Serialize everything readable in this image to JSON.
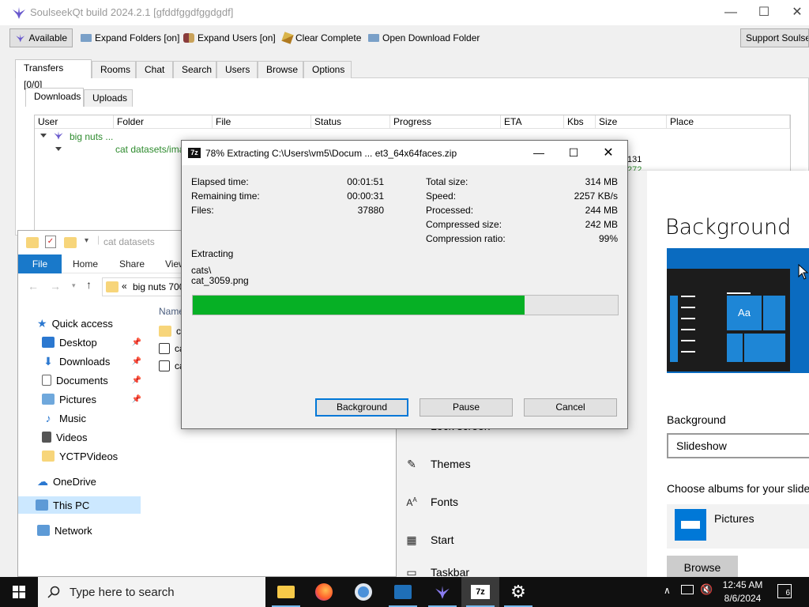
{
  "soulseek": {
    "title": "SoulseekQt build 2024.2.1 [gfddfggdfggdgdf]",
    "toolbar": {
      "available": "Available",
      "expand_folders": "Expand Folders [on]",
      "expand_users": "Expand Users [on]",
      "clear_complete": "Clear Complete",
      "open_download_folder": "Open Download Folder",
      "support": "Support Soulseek"
    },
    "tabs": [
      "Transfers [0/0]",
      "Rooms",
      "Chat",
      "Search",
      "Users",
      "Browse",
      "Options"
    ],
    "subtabs": [
      "Downloads",
      "Uploads"
    ],
    "columns": [
      "User",
      "Folder",
      "File",
      "Status",
      "Progress",
      "ETA",
      "Kbs",
      "Size",
      "Place"
    ],
    "row_user": "big nuts ...",
    "row_folder": "cat datasets/imag",
    "row_size_1": "131",
    "row_size_2": "272"
  },
  "zip": {
    "title": "78% Extracting C:\\Users\\vm5\\Docum ... et3_64x64faces.zip",
    "logo": "7z",
    "elapsed_label": "Elapsed time:",
    "elapsed_value": "00:01:51",
    "remaining_label": "Remaining time:",
    "remaining_value": "00:00:31",
    "files_label": "Files:",
    "files_value": "37880",
    "total_label": "Total size:",
    "total_value": "314 MB",
    "speed_label": "Speed:",
    "speed_value": "2257 KB/s",
    "processed_label": "Processed:",
    "processed_value": "244 MB",
    "compressed_label": "Compressed size:",
    "compressed_value": "242 MB",
    "ratio_label": "Compression ratio:",
    "ratio_value": "99%",
    "extracting_label": "Extracting",
    "current_dir": "cats\\",
    "current_file": "cat_3059.png",
    "progress": 0.78,
    "buttons": {
      "background": "Background",
      "pause": "Pause",
      "cancel": "Cancel"
    }
  },
  "explorer": {
    "title": "cat datasets",
    "ribbon": [
      "File",
      "Home",
      "Share",
      "View"
    ],
    "address": "big nuts 700",
    "address_prefix": "«",
    "column_name": "Name",
    "files": [
      "ca",
      "ca",
      "ca"
    ],
    "sidebar": {
      "quick_access": "Quick access",
      "items": [
        "Desktop",
        "Downloads",
        "Documents",
        "Pictures",
        "Music",
        "Videos",
        "YCTPVideos"
      ],
      "onedrive": "OneDrive",
      "this_pc": "This PC",
      "network": "Network"
    }
  },
  "settings": {
    "heading": "Background",
    "preview_tile": "Aa",
    "background_label": "Background",
    "background_value": "Slideshow",
    "albums_label": "Choose albums for your slide",
    "album_name": "Pictures",
    "browse": "Browse",
    "nav": [
      "Lock screen",
      "Themes",
      "Fonts",
      "Start",
      "Taskbar"
    ]
  },
  "taskbar": {
    "search_placeholder": "Type here to search",
    "time": "12:45 AM",
    "date": "8/6/2024",
    "notifications": "6"
  },
  "colors": {
    "progress_green": "#06b025",
    "accent_blue": "#0078d7",
    "file_tab_blue": "#1979ca"
  }
}
